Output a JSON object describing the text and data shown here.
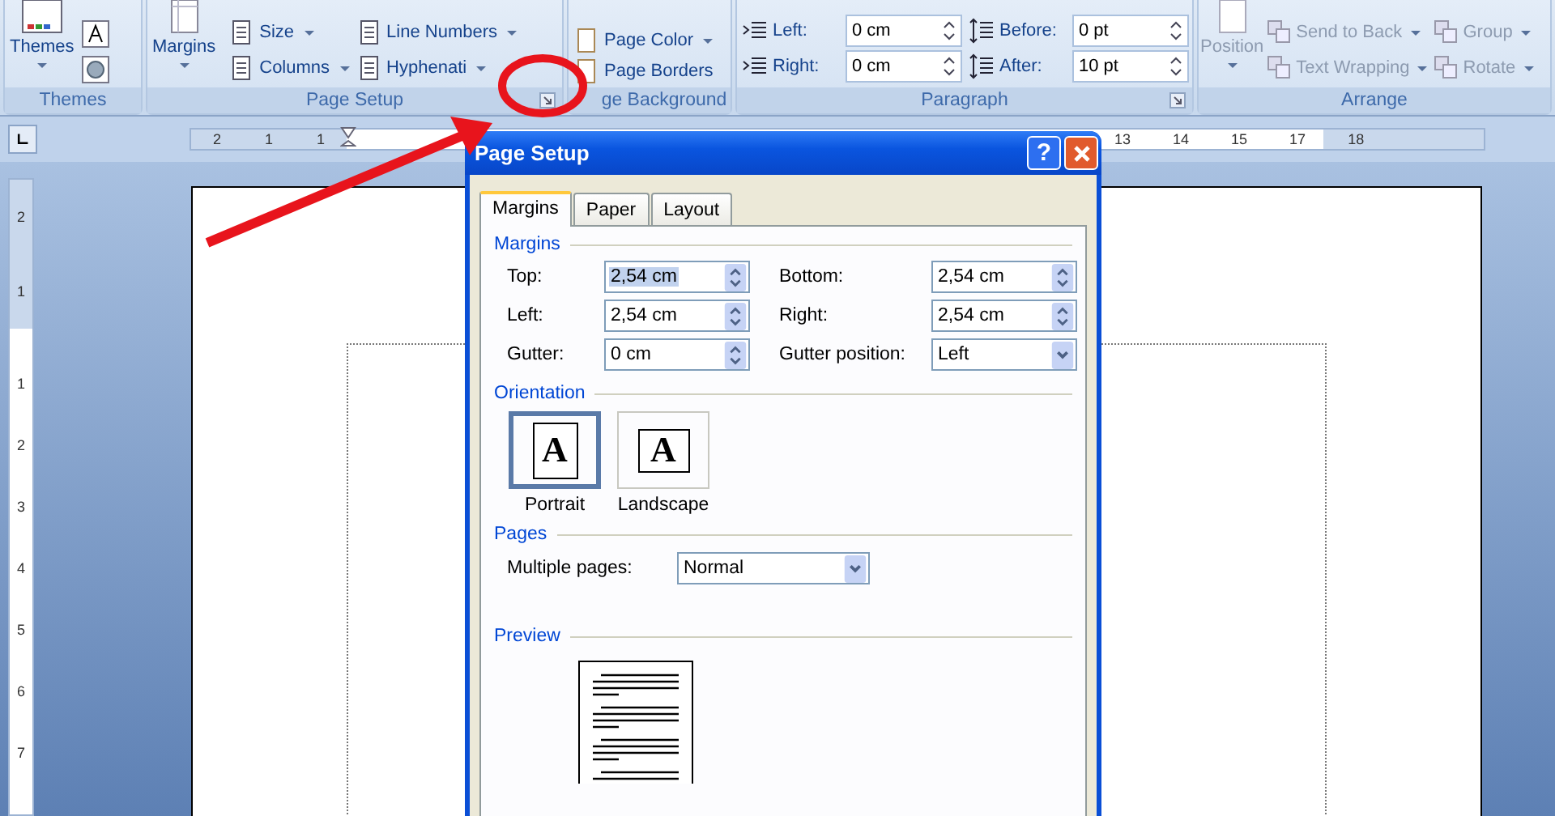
{
  "ribbon": {
    "themes": {
      "label": "Themes",
      "button": "Themes"
    },
    "page_setup": {
      "label": "Page Setup",
      "margins": "Margins",
      "items": [
        {
          "label": "Size",
          "dropdown": true
        },
        {
          "label": "Line Numbers",
          "dropdown": true
        },
        {
          "label": "Columns",
          "dropdown": true
        },
        {
          "label": "Hyphenati",
          "dropdown": true
        }
      ]
    },
    "page_background": {
      "label": "ge Background",
      "items": [
        {
          "label": "Page Color",
          "dropdown": true
        },
        {
          "label": "Page Borders",
          "dropdown": false
        }
      ]
    },
    "paragraph": {
      "label": "Paragraph",
      "indent": [
        {
          "label": "Left:",
          "value": "0 cm"
        },
        {
          "label": "Right:",
          "value": "0 cm"
        }
      ],
      "spacing": [
        {
          "label": "Before:",
          "value": "0 pt"
        },
        {
          "label": "After:",
          "value": "10 pt"
        }
      ]
    },
    "arrange": {
      "label": "Arrange",
      "position": {
        "label": "Position",
        "disabled": true
      },
      "items": [
        {
          "label": "Send to Back",
          "disabled": true,
          "dropdown": true
        },
        {
          "label": "Group",
          "disabled": true,
          "dropdown": true
        },
        {
          "label": "Text Wrapping",
          "disabled": true,
          "dropdown": true
        },
        {
          "label": "Rotate",
          "disabled": true,
          "dropdown": true
        }
      ]
    }
  },
  "ruler": {
    "left_labels": [
      "2",
      "1",
      "1"
    ],
    "right_labels": [
      "13",
      "14",
      "15",
      "17",
      "18"
    ]
  },
  "vertical_ruler": {
    "top_labels": [
      "2",
      "1"
    ],
    "labels": [
      "1",
      "2",
      "3",
      "4",
      "5",
      "6",
      "7"
    ]
  },
  "dialog": {
    "title": "Page Setup",
    "help_button": "?",
    "tabs": [
      {
        "label": "Margins",
        "selected": true
      },
      {
        "label": "Paper",
        "selected": false
      },
      {
        "label": "Layout",
        "selected": false
      }
    ],
    "margins": {
      "legend": "Margins",
      "fields": [
        {
          "label": "Top:",
          "value": "2,54 cm",
          "kind": "spin",
          "highlighted": true
        },
        {
          "label": "Bottom:",
          "value": "2,54 cm",
          "kind": "spin",
          "highlighted": false
        },
        {
          "label": "Left:",
          "value": "2,54 cm",
          "kind": "spin",
          "highlighted": false
        },
        {
          "label": "Right:",
          "value": "2,54 cm",
          "kind": "spin",
          "highlighted": false
        },
        {
          "label": "Gutter:",
          "value": "0 cm",
          "kind": "spin",
          "highlighted": false
        },
        {
          "label": "Gutter position:",
          "value": "Left",
          "kind": "dropdown",
          "highlighted": false
        }
      ]
    },
    "orientation": {
      "legend": "Orientation",
      "options": [
        {
          "label": "Portrait",
          "glyph": "A",
          "selected": true,
          "kind": "portrait"
        },
        {
          "label": "Landscape",
          "glyph": "A",
          "selected": false,
          "kind": "landscape"
        }
      ]
    },
    "pages": {
      "legend": "Pages",
      "label": "Multiple pages:",
      "value": "Normal"
    },
    "preview": {
      "legend": "Preview"
    }
  }
}
